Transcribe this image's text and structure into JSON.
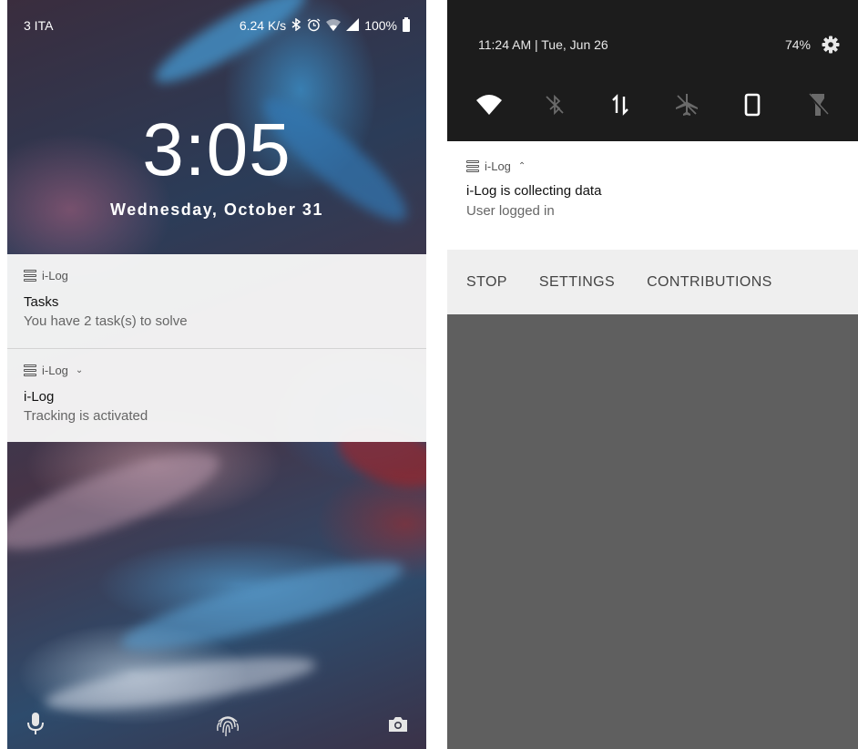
{
  "lock_screen": {
    "status": {
      "carrier": "3 ITA",
      "speed": "6.24 K/s",
      "battery": "100%",
      "icons": [
        "bluetooth-icon",
        "alarm-icon",
        "wifi-icon",
        "signal-icon",
        "battery-icon"
      ]
    },
    "clock": "3:05",
    "date": "Wednesday, October 31",
    "notifications": [
      {
        "app": "i-Log",
        "title": "Tasks",
        "text": "You have 2 task(s) to solve",
        "expandable": false
      },
      {
        "app": "i-Log",
        "title": "i-Log",
        "text": "Tracking is activated",
        "expandable": true
      }
    ],
    "bottom_icons": [
      "mic-icon",
      "fingerprint-icon",
      "camera-icon"
    ]
  },
  "shade": {
    "status": {
      "time_date": "11:24 AM | Tue, Jun 26",
      "battery": "74%"
    },
    "quick_settings": [
      "wifi-icon",
      "bluetooth-icon",
      "mobile-data-icon",
      "airplane-mode-icon",
      "auto-rotate-icon",
      "flashlight-icon"
    ],
    "notification": {
      "app": "i-Log",
      "title": "i-Log is collecting data",
      "text": "User logged in",
      "expanded": true
    },
    "actions": [
      "STOP",
      "SETTINGS",
      "CONTRIBUTIONS"
    ]
  },
  "colors": {
    "shade_dark": "#1c1c1c",
    "shade_background": "#5f5f5f",
    "notification_bg": "#ffffff",
    "actions_bg": "#efefef"
  }
}
